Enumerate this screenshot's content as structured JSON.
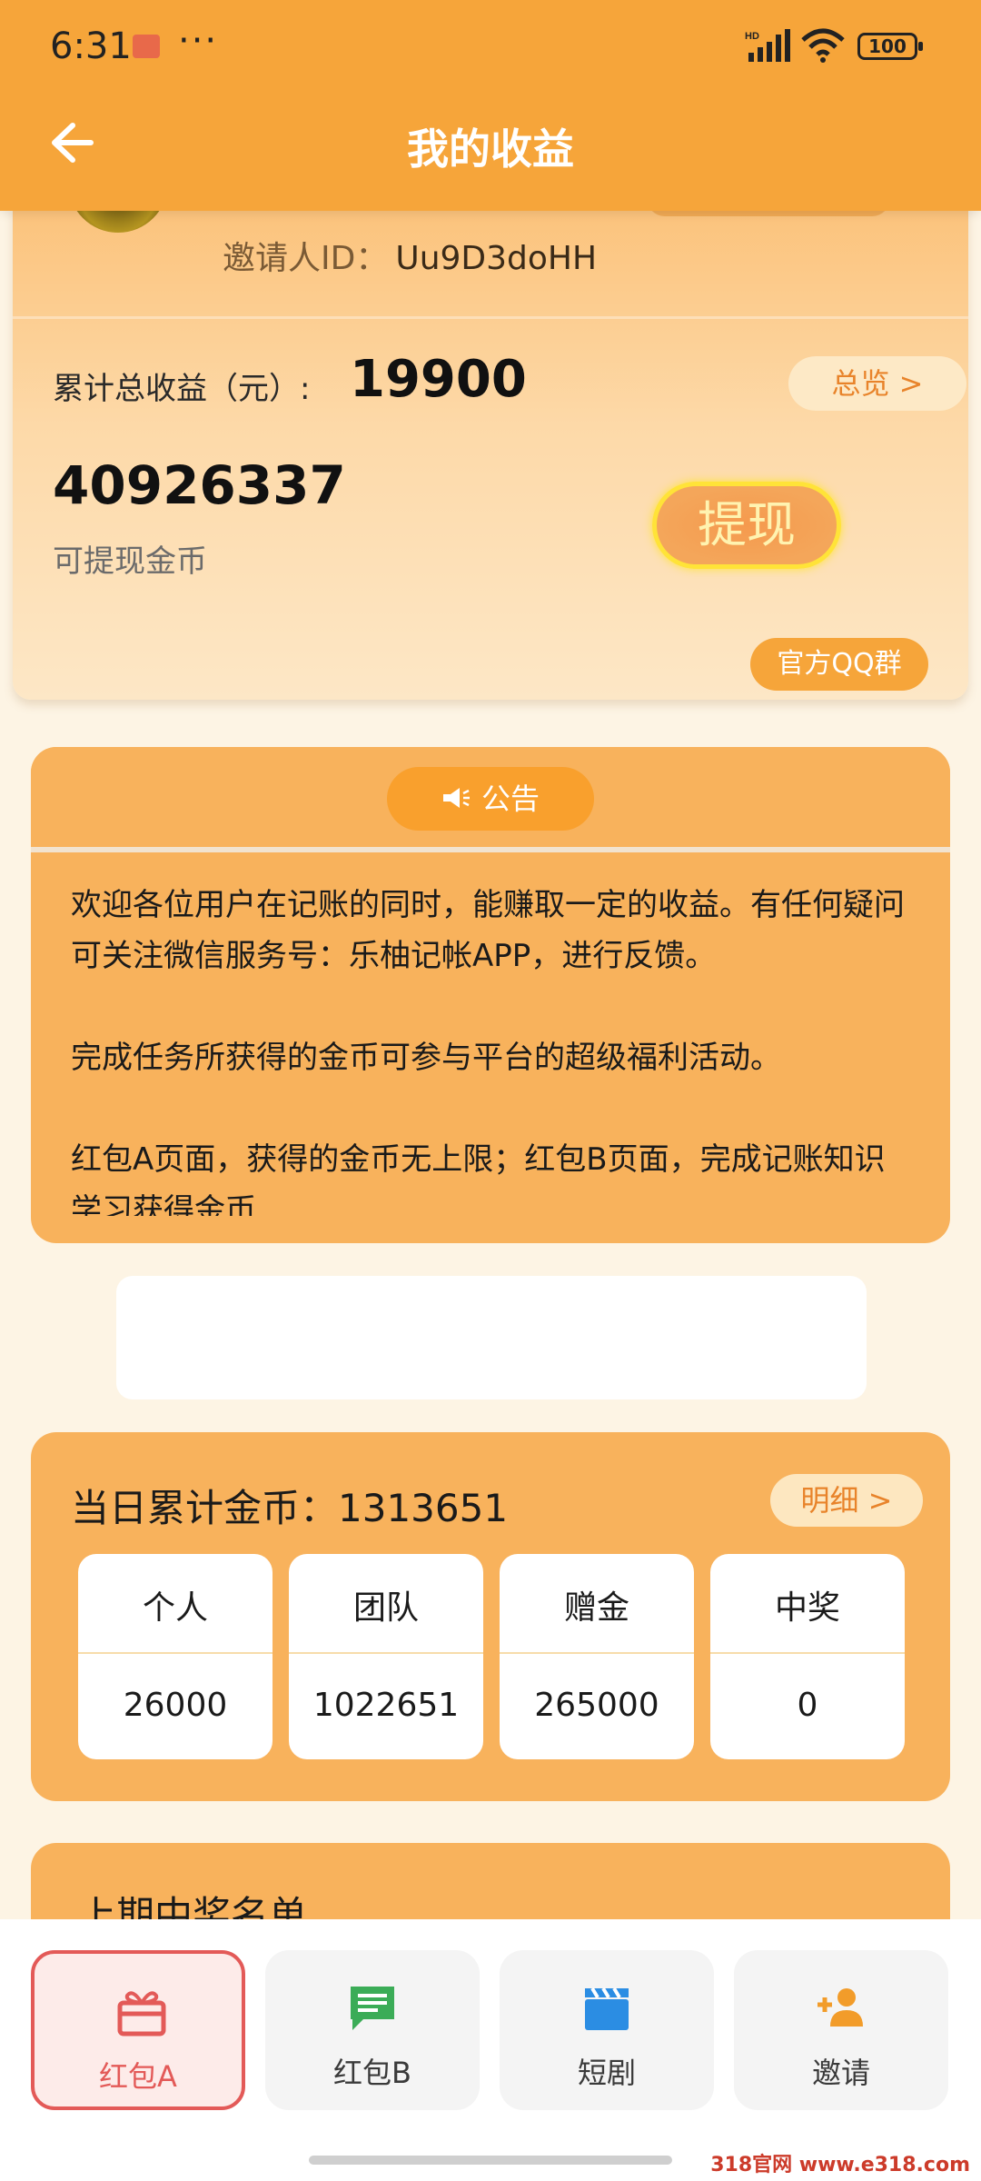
{
  "status_bar": {
    "time": "6:31",
    "battery": "100",
    "network": "HD"
  },
  "header": {
    "title": "我的收益"
  },
  "account": {
    "inviter_label": "邀请人ID：",
    "inviter_id": "Uu9D3doHH"
  },
  "earnings": {
    "total_label": "累计总收益（元）:",
    "total_value": "19900",
    "overview_label": "总览 >",
    "coins_value": "40926337",
    "coins_label": "可提现金币",
    "withdraw_label": "提现",
    "qq_group_label": "官方QQ群"
  },
  "notice": {
    "title": "公告",
    "paragraphs": [
      "欢迎各位用户在记账的同时，能赚取一定的收益。有任何疑问可关注微信服务号：乐柚记帐APP，进行反馈。",
      "完成任务所获得的金币可参与平台的超级福利活动。",
      "红包A页面，获得的金币无上限；红包B页面，完成记账知识学习获得金币"
    ]
  },
  "daily": {
    "title": "当日累计金币：1313651",
    "detail_label": "明细 >",
    "stats": [
      {
        "label": "个人",
        "value": "26000"
      },
      {
        "label": "团队",
        "value": "1022651"
      },
      {
        "label": "赠金",
        "value": "265000"
      },
      {
        "label": "中奖",
        "value": "0"
      }
    ]
  },
  "winners": {
    "title": "上期中奖名单"
  },
  "bottom_nav": [
    {
      "label": "红包A",
      "icon": "gift-icon",
      "active": true
    },
    {
      "label": "红包B",
      "icon": "message-icon",
      "active": false
    },
    {
      "label": "短剧",
      "icon": "clapperboard-icon",
      "active": false
    },
    {
      "label": "邀请",
      "icon": "add-user-icon",
      "active": false
    }
  ],
  "watermark": "318官网 www.e318.com",
  "colors": {
    "primary": "#f6a53a",
    "accent_red": "#e35a58",
    "gold": "#ffe338"
  }
}
